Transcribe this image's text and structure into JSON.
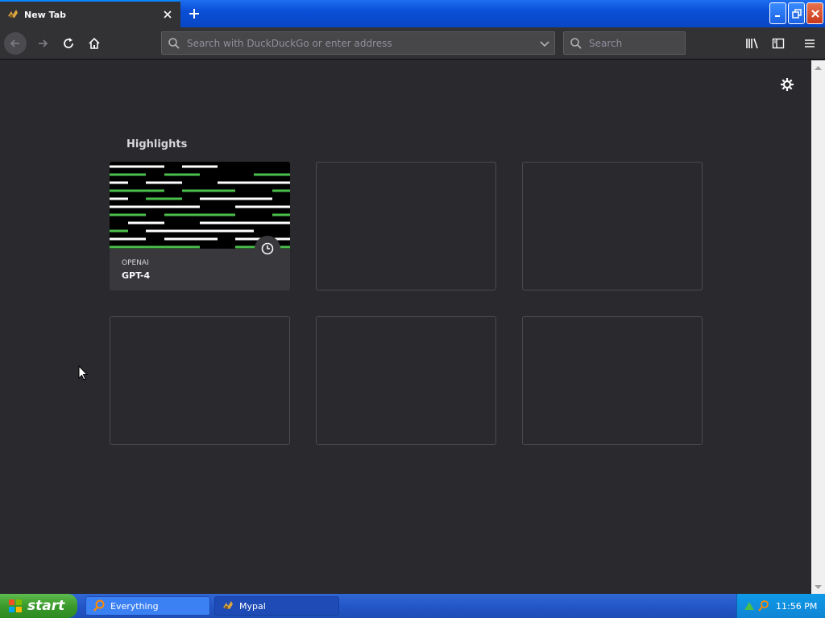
{
  "browser": {
    "tab": {
      "title": "New Tab"
    },
    "urlbar": {
      "placeholder": "Search with DuckDuckGo or enter address"
    },
    "searchbar": {
      "placeholder": "Search"
    }
  },
  "newtab": {
    "section_title": "Highlights",
    "highlights": [
      {
        "host": "OPENAI",
        "title": "GPT-4",
        "badge": "clock-icon"
      }
    ],
    "empty_slots": 5
  },
  "taskbar": {
    "start_label": "start",
    "items": [
      {
        "label": "Everything",
        "icon": "magnifier-icon"
      },
      {
        "label": "Mypal",
        "icon": "mypal-icon"
      }
    ],
    "clock": "11:56 PM"
  },
  "colors": {
    "accent": "#0a84ff",
    "thumb_green": "#4bbf4b",
    "thumb_white": "#ffffff"
  }
}
